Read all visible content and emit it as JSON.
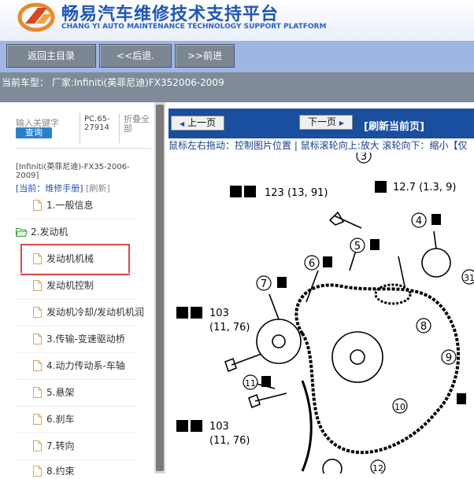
{
  "header": {
    "title": "畅易汽车维修技术支持平台",
    "subtitle": "CHANG YI AUTO MAINTENANCE TECHNOLOGY SUPPORT PLATFORM"
  },
  "nav": {
    "home": "返回主目录",
    "back": "<<后退.",
    "forward": ">>前进"
  },
  "vehicle": {
    "text": "当前车型： 厂家:Infiniti(英菲尼迪)FX352006-2009"
  },
  "search": {
    "label": "输入关键字",
    "button": "查询",
    "pc_code": "PC.65-27914",
    "fold": "折叠全部"
  },
  "breadcrumb": {
    "model": "[Infiniti(英菲尼迪)-FX35-2006-2009]",
    "current": "[当前：维修手册]",
    "refresh": "[刷新]"
  },
  "tree": {
    "items": [
      {
        "label": "1.一般信息"
      },
      {
        "label": "2.发动机"
      },
      {
        "label": "发动机机械"
      },
      {
        "label": "发动机控制"
      },
      {
        "label": "发动机冷却/发动机机润"
      },
      {
        "label": "3.传输-变速驱动桥"
      },
      {
        "label": "4.动力传动系-车轴"
      },
      {
        "label": "5.悬架"
      },
      {
        "label": "6.刹车"
      },
      {
        "label": "7.转向"
      },
      {
        "label": "8.约束"
      }
    ]
  },
  "viewer": {
    "prev": "上一页",
    "next": "下一页",
    "refresh": "[刷新当前页]",
    "hint": "鼠标左右拖动：控制图片位置 | 鼠标滚轮向上:放大  滚轮向下：缩小【仅"
  },
  "diagram": {
    "labels": {
      "a": "123 (13, 91)",
      "b": "12.7 (1.3, 9)",
      "c": "103",
      "d": "(11, 76)",
      "e": "103",
      "f": "(11, 76)"
    },
    "callouts": [
      "3",
      "4",
      "5",
      "6",
      "7",
      "8",
      "9",
      "10",
      "11",
      "12",
      "31"
    ]
  },
  "colors": {
    "title": "#1f56b5",
    "nav_bar": "#9eb6e3",
    "vehicle_bar": "#7f8b98",
    "viewer_toolbar": "#1a4e9e",
    "highlight": "#d94a4a"
  }
}
